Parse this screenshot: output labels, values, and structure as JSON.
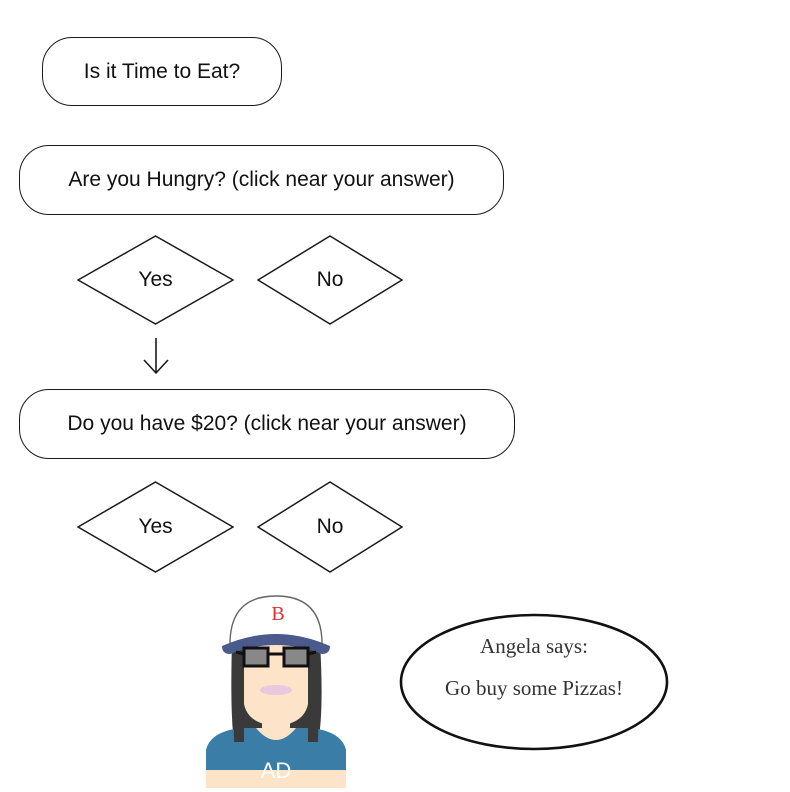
{
  "flow": {
    "title": "Is it Time to Eat?",
    "q1": {
      "question": "Are you Hungry? (click near your answer)",
      "yes": "Yes",
      "no": "No"
    },
    "q2": {
      "question": "Do you have $20? (click near your answer)",
      "yes": "Yes",
      "no": "No"
    }
  },
  "avatar": {
    "cap_letter": "B",
    "shirt_text": "AD"
  },
  "speech": {
    "line1": "Angela says:",
    "line2": "Go buy some Pizzas!"
  },
  "colors": {
    "cap": "#4a5a8c",
    "shirt": "#3a7ea8",
    "cap_letter": "#e03030",
    "skin": "#fde3c8",
    "hair": "#3a3a3a"
  }
}
